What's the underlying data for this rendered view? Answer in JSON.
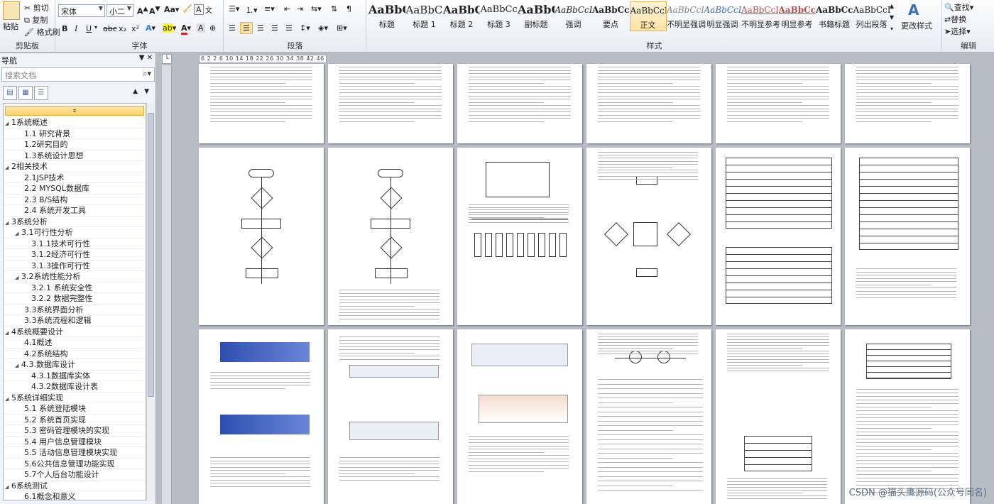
{
  "clipboard": {
    "paste": "粘贴",
    "cut": "剪切",
    "copy": "复制",
    "format_painter": "格式刷",
    "label": "剪贴板"
  },
  "font": {
    "family": "宋体",
    "size": "小二",
    "label": "字体",
    "buttons": [
      "B",
      "I",
      "U",
      "abc",
      "x₂",
      "x²",
      "A"
    ]
  },
  "paragraph": {
    "label": "段落"
  },
  "styles": {
    "label": "样式",
    "items": [
      {
        "sample": "AaBbC",
        "name": "标题"
      },
      {
        "sample": "AaBbCc",
        "name": "标题 1"
      },
      {
        "sample": "AaBbC",
        "name": "标题 2"
      },
      {
        "sample": "AaBbCcD",
        "name": "标题 3"
      },
      {
        "sample": "AaBbC",
        "name": "副标题"
      },
      {
        "sample": "AaBbCcDd",
        "name": "强调"
      },
      {
        "sample": "AaBbCcDd",
        "name": "要点"
      },
      {
        "sample": "AaBbCcDd",
        "name": "正文"
      },
      {
        "sample": "AaBbCcDd",
        "name": "不明显强调"
      },
      {
        "sample": "AaBbCcDd",
        "name": "明显强调"
      },
      {
        "sample": "AaBbCcDd",
        "name": "不明显参考"
      },
      {
        "sample": "AaBbCcDd",
        "name": "明显参考"
      },
      {
        "sample": "AaBbCcDd",
        "name": "书籍标题"
      },
      {
        "sample": "AaBbCcDd",
        "name": "列出段落"
      }
    ],
    "active_index": 7,
    "change_styles": "更改样式"
  },
  "editing": {
    "label": "编辑",
    "find": "查找",
    "replace": "替换",
    "select": "选择"
  },
  "nav": {
    "title": "导航",
    "search_placeholder": "搜索文档",
    "items": [
      {
        "level": 1,
        "text": "1系统概述"
      },
      {
        "level": 2,
        "text": "1.1 研究背景"
      },
      {
        "level": 2,
        "text": "1.2研究目的"
      },
      {
        "level": 2,
        "text": "1.3系统设计思想"
      },
      {
        "level": 1,
        "text": "2相关技术"
      },
      {
        "level": 2,
        "text": "2.1JSP技术"
      },
      {
        "level": 2,
        "text": "2.2 MYSQL数据库"
      },
      {
        "level": 2,
        "text": "2.3 B/S结构"
      },
      {
        "level": 2,
        "text": "2.4 系统开发工具"
      },
      {
        "level": 1,
        "text": "3系统分析"
      },
      {
        "level": 2,
        "text": "3.1可行性分析"
      },
      {
        "level": 3,
        "text": "3.1.1技术可行性"
      },
      {
        "level": 3,
        "text": "3.1.2经济可行性"
      },
      {
        "level": 3,
        "text": "3.1.3操作可行性"
      },
      {
        "level": 2,
        "text": "3.2系统性能分析"
      },
      {
        "level": 3,
        "text": "3.2.1 系统安全性"
      },
      {
        "level": 3,
        "text": "3.2.2 数据完整性"
      },
      {
        "level": 2,
        "text": "3.3系统界面分析"
      },
      {
        "level": 2,
        "text": "3.3系统流程和逻辑"
      },
      {
        "level": 1,
        "text": "4系统概要设计"
      },
      {
        "level": 2,
        "text": "4.1概述"
      },
      {
        "level": 2,
        "text": "4.2系统结构"
      },
      {
        "level": 2,
        "text": "4.3.数据库设计"
      },
      {
        "level": 3,
        "text": "4.3.1数据库实体"
      },
      {
        "level": 3,
        "text": "4.3.2数据库设计表"
      },
      {
        "level": 1,
        "text": "5系统详细实现"
      },
      {
        "level": 2,
        "text": "5.1 系统登陆模块"
      },
      {
        "level": 2,
        "text": "5.2 系统首页实现"
      },
      {
        "level": 2,
        "text": "5.3 密码管理模块的实现"
      },
      {
        "level": 2,
        "text": "5.4 用户信息管理模块"
      },
      {
        "level": 2,
        "text": "5.5 活动信息管理模块实现"
      },
      {
        "level": 2,
        "text": "5.6公共信息管理功能实现"
      },
      {
        "level": 2,
        "text": "5.7个人后台功能设计"
      },
      {
        "level": 1,
        "text": "6系统测试"
      },
      {
        "level": 2,
        "text": "6.1概念和意义"
      }
    ]
  },
  "ruler": {
    "ticks": "6  2  2  6  10  14  18  22  26  30  34  38  42  46"
  },
  "watermark": "CSDN @猫头鹰源码(公众号同名)"
}
